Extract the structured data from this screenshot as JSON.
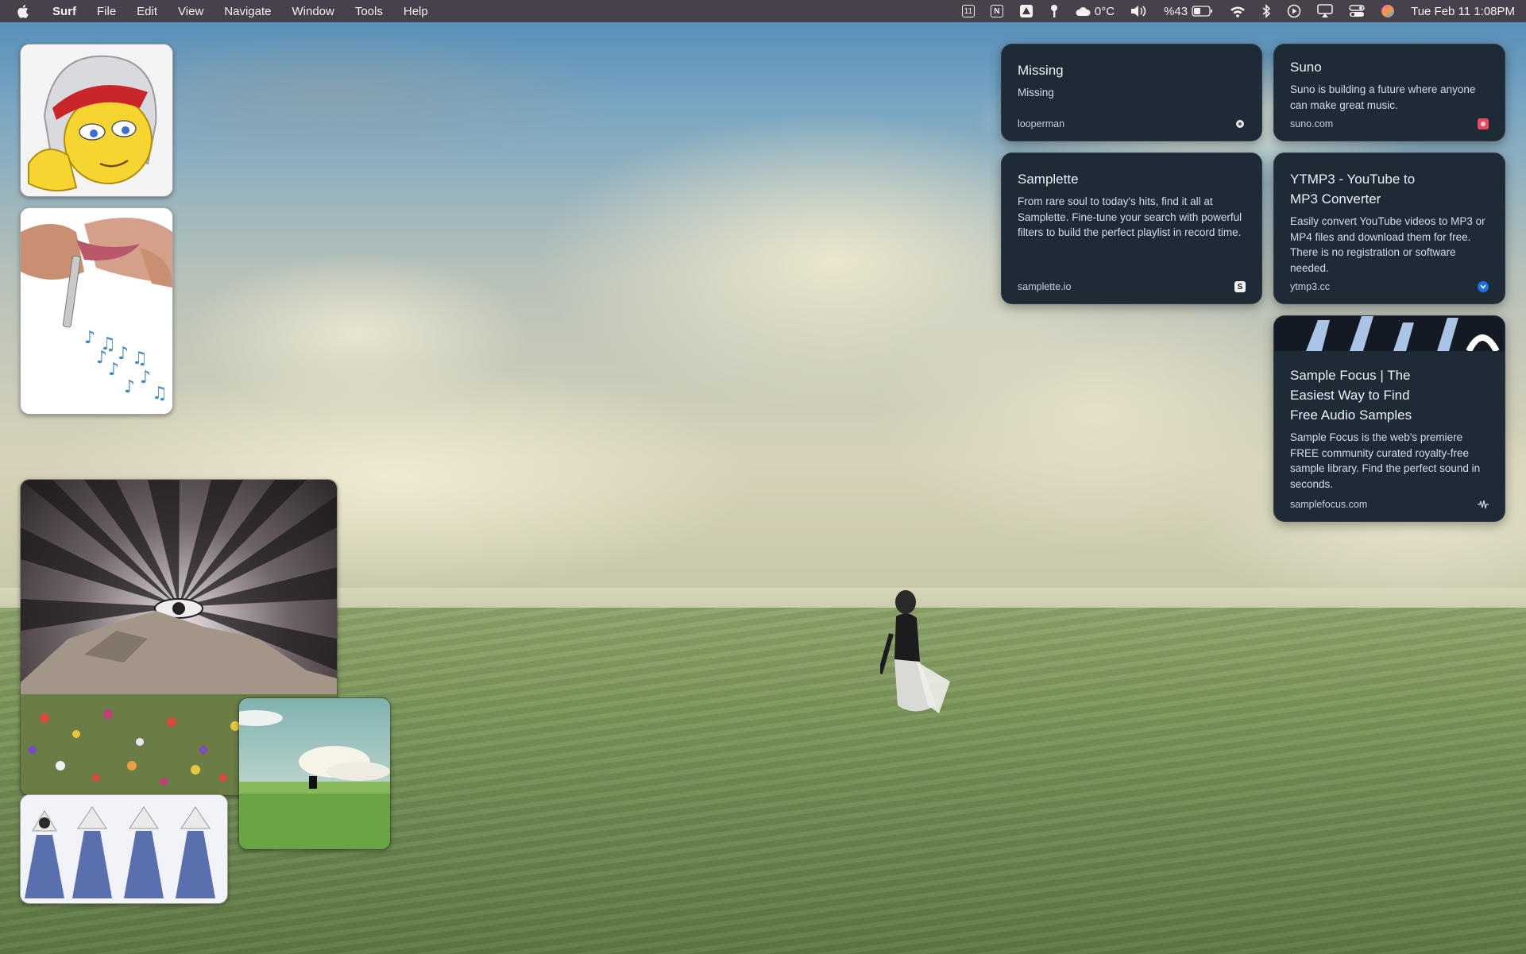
{
  "menubar": {
    "app_name": "Surf",
    "menu_items": [
      "File",
      "Edit",
      "View",
      "Navigate",
      "Window",
      "Tools",
      "Help"
    ],
    "status": {
      "calendar_badge": "11",
      "notion_badge": "N",
      "weather": "0°C",
      "battery": "%43",
      "datetime": "Tue Feb 11  1:08PM"
    }
  },
  "cards": [
    {
      "title": "Missing",
      "description": "Missing",
      "domain": "looperman",
      "icon": "looperman-favicon"
    },
    {
      "title": "Suno",
      "description": "Suno is building a future where anyone can make great music.",
      "domain": "suno.com",
      "icon": "suno-favicon"
    },
    {
      "title": "Samplette",
      "description": "From rare soul to today's hits, find it all at Samplette. Fine-tune your search with powerful filters to build the perfect playlist in record time.",
      "domain": "samplette.io",
      "icon": "samplette-favicon",
      "icon_letter": "S"
    },
    {
      "title": "YTMP3 - YouTube to MP3 Converter",
      "description": "Easily convert YouTube videos to MP3 or MP4 files and download them for free. There is no registration or software needed.",
      "domain": "ytmp3.cc",
      "icon": "ytmp3-favicon"
    },
    {
      "title": "Sample Focus | The Easiest Way to Find Free Audio Samples",
      "description": "Sample Focus is the web's premiere FREE community curated royalty-free sample library. Find the perfect sound in seconds.",
      "domain": "samplefocus.com",
      "icon": "samplefocus-favicon"
    }
  ],
  "colors": {
    "card_bg": "#1f2a37",
    "menubar_bg": "#46373c",
    "ytmp3_accent": "#1e6fe0",
    "suno_accent": "#e84a5f"
  }
}
